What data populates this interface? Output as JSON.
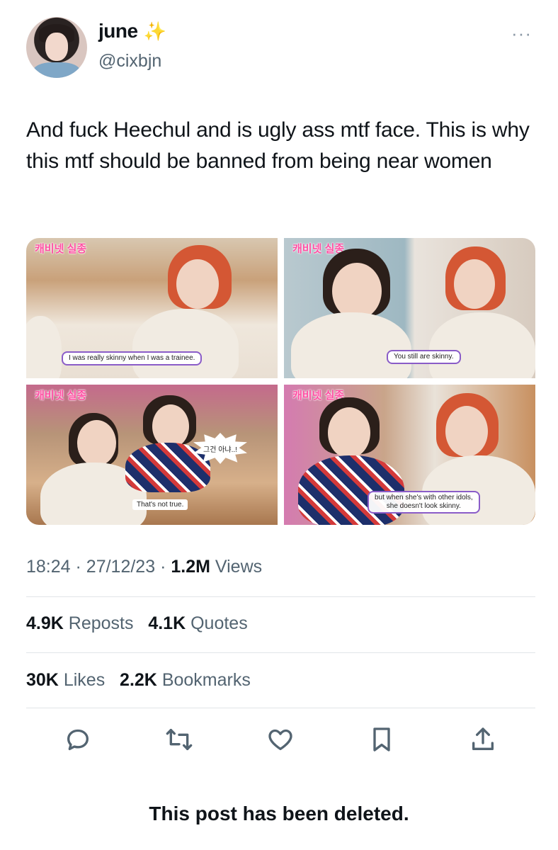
{
  "author": {
    "display_name": "june",
    "handle": "@cixbjn",
    "badge_icon": "sparkles-icon"
  },
  "tweet": {
    "text": "And fuck Heechul and is ugly ass mtf face. This is why this mtf should be banned from being near women"
  },
  "media": {
    "frame1": {
      "logo": "캐비넷 실종",
      "subtitle": "I was really skinny when I was a trainee."
    },
    "frame2": {
      "logo": "캐비넷 실종",
      "subtitle": "You still are skinny."
    },
    "frame3": {
      "logo": "캐비넷 실종",
      "bubble": "그건 아냐..!",
      "subtitle": "That's not true."
    },
    "frame4": {
      "logo": "캐비넷 실종",
      "subtitle_line1": "but when she's with other idols,",
      "subtitle_line2": "she doesn't look skinny."
    }
  },
  "meta": {
    "time": "18:24",
    "date": "27/12/23",
    "views_count": "1.2M",
    "views_label": "Views",
    "separator": "·"
  },
  "stats": {
    "reposts_count": "4.9K",
    "reposts_label": "Reposts",
    "quotes_count": "4.1K",
    "quotes_label": "Quotes",
    "likes_count": "30K",
    "likes_label": "Likes",
    "bookmarks_count": "2.2K",
    "bookmarks_label": "Bookmarks"
  },
  "actions": [
    "reply-icon",
    "retweet-icon",
    "like-icon",
    "bookmark-icon",
    "share-icon"
  ],
  "notice": "This post has been deleted.",
  "colors": {
    "text_primary": "#0f1419",
    "text_secondary": "#536471",
    "divider": "#e1e5e8",
    "sparkle": "#f4c542"
  }
}
